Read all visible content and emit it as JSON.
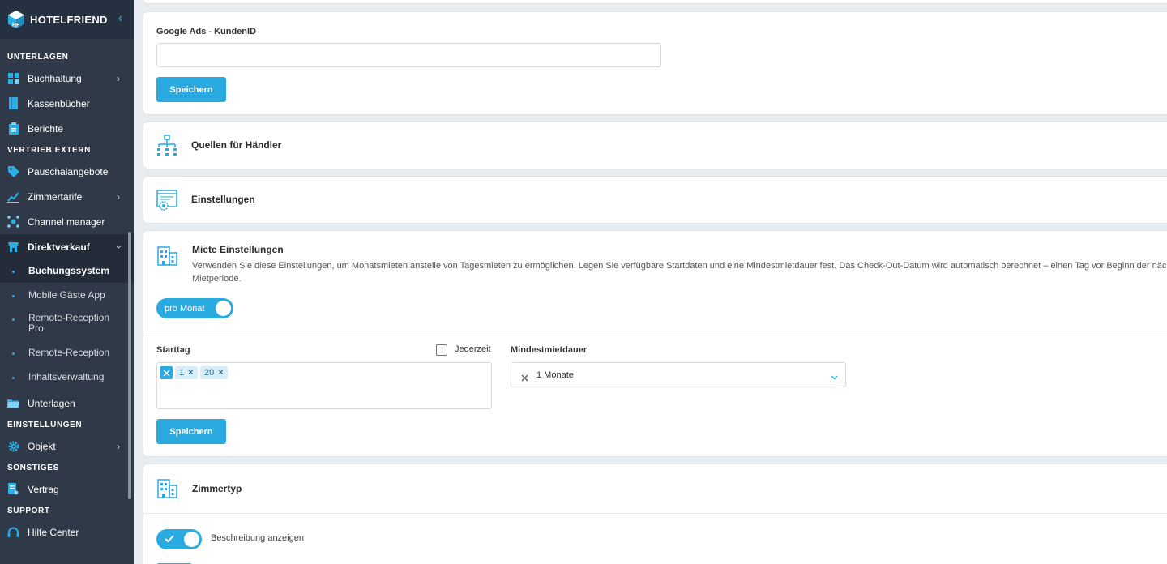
{
  "brand": {
    "name": "HOTELFRIEND",
    "logo_letters": "HF"
  },
  "sidebar": {
    "sections": [
      {
        "label": "UNTERLAGEN"
      },
      {
        "label": "VERTRIEB EXTERN"
      },
      {
        "label": "EINSTELLUNGEN"
      },
      {
        "label": "SONSTIGES"
      },
      {
        "label": "SUPPORT"
      }
    ],
    "items": {
      "buchhaltung": "Buchhaltung",
      "kassenbuecher": "Kassenbücher",
      "berichte": "Berichte",
      "pauschalangebote": "Pauschalangebote",
      "zimmertarife": "Zimmertarife",
      "channel_manager": "Channel manager",
      "direktverkauf": "Direktverkauf",
      "unterlagen": "Unterlagen",
      "objekt": "Objekt",
      "vertrag": "Vertrag",
      "hilfe_center": "Hilfe Center"
    },
    "sub_items": {
      "buchungssystem": "Buchungssystem",
      "mobile_gaeste_app": "Mobile Gäste App",
      "remote_reception_pro_1": "Remote-Reception",
      "remote_reception_pro_2": "Pro",
      "remote_reception": "Remote-Reception",
      "inhaltsverwaltung": "Inhaltsverwaltung"
    }
  },
  "google_ads": {
    "label": "Google Ads - KundenID",
    "value": "",
    "save_label": "Speichern"
  },
  "quellen": {
    "title": "Quellen für Händler"
  },
  "einstellungen": {
    "title": "Einstellungen"
  },
  "miete": {
    "title": "Miete Einstellungen",
    "description_line1": "Verwenden Sie diese Einstellungen, um Monatsmieten anstelle von Tagesmieten zu ermöglichen. Legen Sie verfügbare Startdaten und eine Mindestmietdauer fest. Das Check-Out-Datum wird automatisch berechnet – einen Tag vor Beginn der nächsten",
    "description_line2": "Mietperiode.",
    "toggle_label": "pro Monat",
    "starttag_label": "Starttag",
    "jederzeit_label": "Jederzeit",
    "tags": [
      "1",
      "20"
    ],
    "tag_remove": "×",
    "mindest_label": "Mindestmietdauer",
    "mindest_value": "1 Monate",
    "save_label": "Speichern"
  },
  "zimmertyp": {
    "title": "Zimmertyp",
    "beschreibung_label": "Beschreibung anzeigen"
  },
  "colors": {
    "accent": "#29abe2",
    "sidebar_bg": "#2f3947",
    "sidebar_active": "#232c38"
  }
}
